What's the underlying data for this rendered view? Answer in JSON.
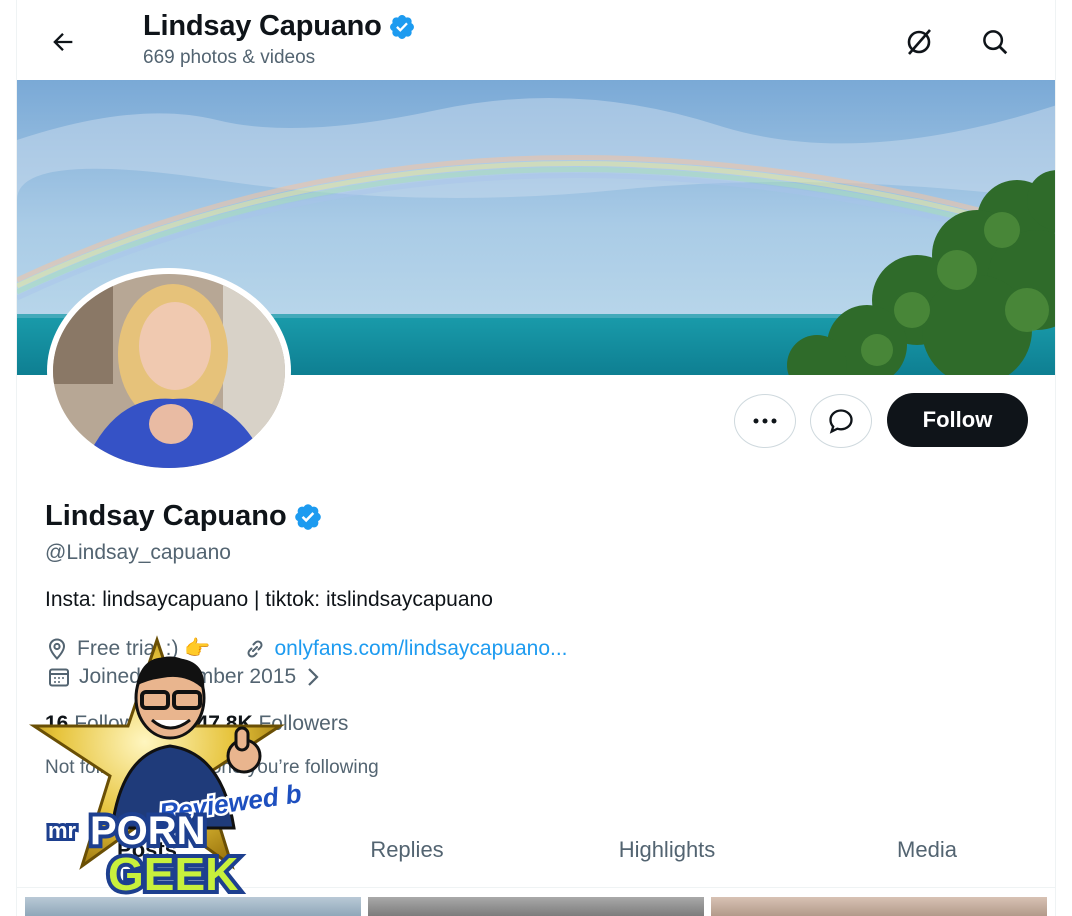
{
  "header": {
    "title": "Lindsay Capuano",
    "subtitle": "669 photos & videos"
  },
  "profile": {
    "name": "Lindsay Capuano",
    "handle": "@Lindsay_capuano",
    "bio": "Insta: lindsaycapuano | tiktok: itslindsaycapuano",
    "location": "Free trial :) 👉",
    "link": "onlyfans.com/lindsaycapuano...",
    "joined": "Joined November 2015",
    "following_count": "16",
    "following_label": "Following",
    "followers_count": "147.8K",
    "followers_label": "Followers",
    "followed_by": "Not followed by anyone you’re following"
  },
  "actions": {
    "follow_label": "Follow"
  },
  "tabs": [
    {
      "label": "Posts",
      "active": true
    },
    {
      "label": "Replies",
      "active": false
    },
    {
      "label": "Highlights",
      "active": false
    },
    {
      "label": "Media",
      "active": false
    }
  ],
  "watermark": {
    "brand_mr": "mr",
    "brand_porn": "PORN",
    "brand_geek": "GEEK",
    "reviewed_by": "Reviewed by"
  },
  "colors": {
    "accent": "#1d9bf0",
    "verified": "#1d9bf0",
    "follow_bg": "#0f1419",
    "secondary_text": "#536471"
  },
  "icons": [
    "back-arrow-icon",
    "verified-badge-icon",
    "no-grok-icon",
    "search-icon",
    "more-icon",
    "message-icon",
    "location-icon",
    "link-icon",
    "calendar-icon",
    "chevron-right-icon"
  ]
}
